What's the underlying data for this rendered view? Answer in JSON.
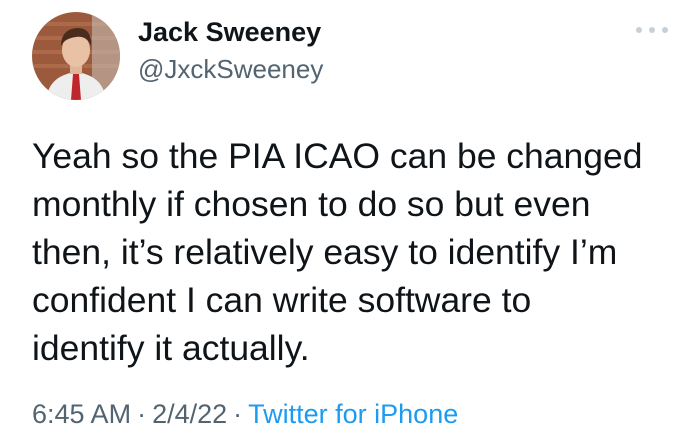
{
  "author": {
    "display_name": "Jack Sweeney",
    "handle": "@JxckSweeney"
  },
  "menu": {
    "icon": "more-horizontal-icon"
  },
  "tweet": {
    "lines": [
      "Yeah so the PIA ICAO can be changed",
      "monthly if chosen to do so but even",
      "then, it’s relatively easy to identify I’m",
      "confident I can write software to",
      "identify it actually."
    ]
  },
  "meta": {
    "time": "6:45 AM",
    "separator": "·",
    "date": "2/4/22",
    "source": "Twitter for iPhone"
  },
  "colors": {
    "text": "#0f1419",
    "secondary": "#536471",
    "link": "#1d9bf0"
  }
}
